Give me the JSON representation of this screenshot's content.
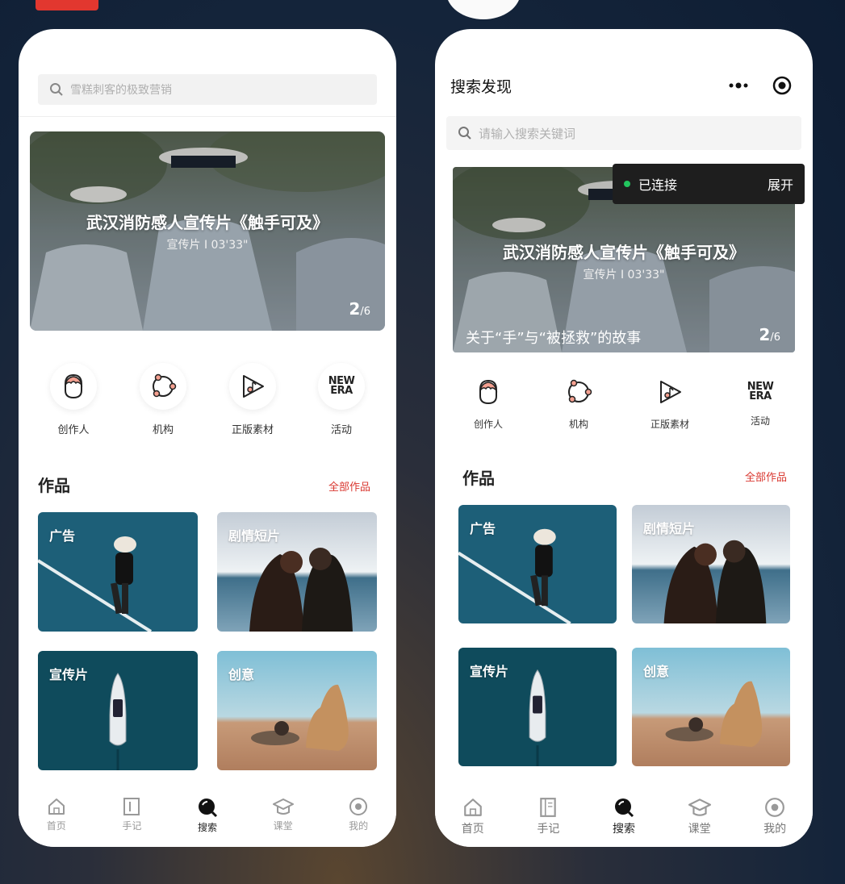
{
  "left": {
    "search_placeholder": "雪糕刺客的极致营销",
    "banner": {
      "title": "武汉消防感人宣传片《触手可及》",
      "subtitle": "宣传片  I 03'33\"",
      "page_current": "2",
      "page_total": "/6"
    },
    "categories": [
      {
        "label": "创作人",
        "icon": "creator-face-icon"
      },
      {
        "label": "机构",
        "icon": "organization-nodes-icon"
      },
      {
        "label": "正版素材",
        "icon": "play-music-icon"
      },
      {
        "label": "活动",
        "icon": "new-era-icon"
      }
    ],
    "section": {
      "title": "作品",
      "more": "全部作品"
    },
    "cards": [
      "广告",
      "剧情短片",
      "宣传片",
      "创意"
    ],
    "tabs": [
      "首页",
      "手记",
      "搜索",
      "课堂",
      "我的"
    ]
  },
  "right": {
    "header_title": "搜索发现",
    "search_placeholder": "请输入搜索关键词",
    "toast": {
      "status": "已连接",
      "expand": "展开"
    },
    "banner": {
      "title": "武汉消防感人宣传片《触手可及》",
      "subtitle": "宣传片  I 03'33\"",
      "caption": "关于“手”与“被拯救”的故事",
      "page_current": "2",
      "page_total": "/6"
    },
    "categories": [
      {
        "label": "创作人",
        "icon": "creator-face-icon"
      },
      {
        "label": "机构",
        "icon": "organization-nodes-icon"
      },
      {
        "label": "正版素材",
        "icon": "play-music-icon"
      },
      {
        "label": "活动",
        "icon": "new-era-icon"
      }
    ],
    "section": {
      "title": "作品",
      "more": "全部作品"
    },
    "cards": [
      "广告",
      "剧情短片",
      "宣传片",
      "创意"
    ],
    "tabs": [
      "首页",
      "手记",
      "搜索",
      "课堂",
      "我的"
    ]
  },
  "newera_text": {
    "line1": "NEW",
    "line2": "ERA"
  },
  "colors": {
    "accent": "#d9372f",
    "connected": "#22c55e"
  }
}
